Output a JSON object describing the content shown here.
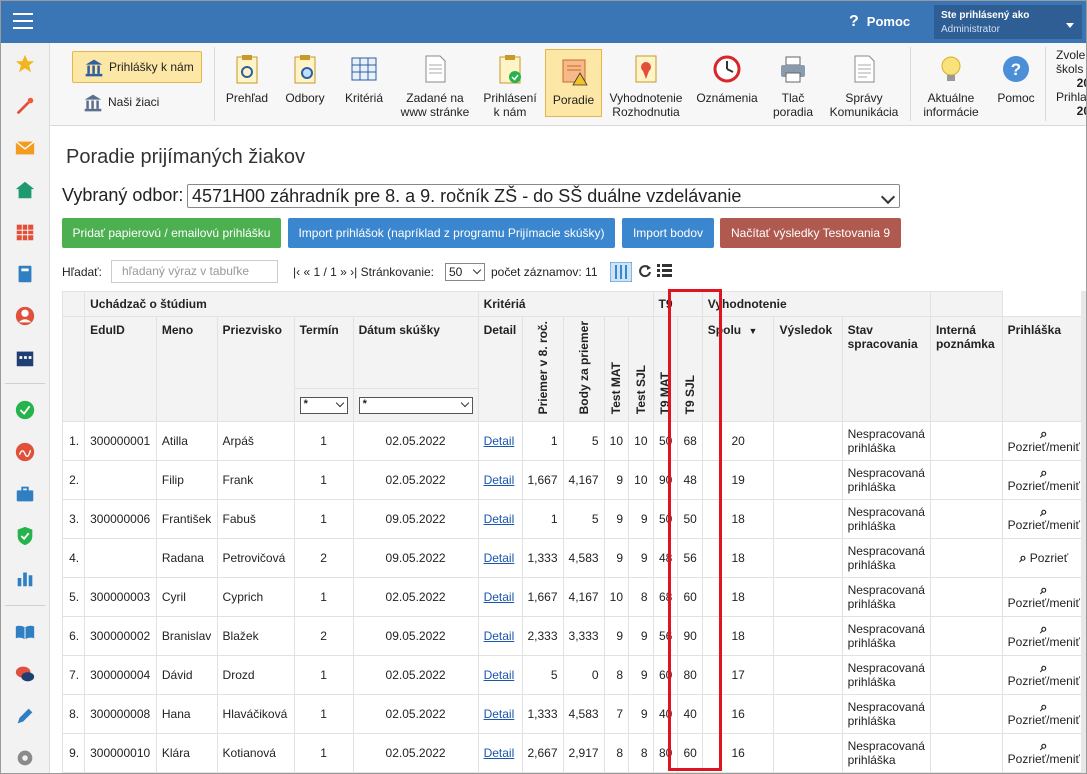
{
  "topbar": {
    "help_label": "Pomoc",
    "user_line1": "Ste prihlásený ako",
    "user_line2": "Administrator"
  },
  "sidebar_icons": [
    "star-icon",
    "magic-wand-icon",
    "mail-icon",
    "home-icon",
    "calendar-grid-icon",
    "book-icon",
    "user-circle-icon",
    "calendar-icon",
    "check-circle-icon",
    "signature-icon",
    "briefcase-icon",
    "shield-check-icon",
    "bar-chart-icon",
    "open-book-icon",
    "chat-icon",
    "pencil-icon",
    "gear-icon"
  ],
  "toolbar": {
    "mini1": "Prihlášky k nám",
    "mini2": "Naši žiaci",
    "items": [
      {
        "label": "Prehľad"
      },
      {
        "label": "Odbory"
      },
      {
        "label": "Kritériá"
      },
      {
        "label": "Zadané na\nwww stránke"
      },
      {
        "label": "Prihlásení\nk nám"
      },
      {
        "label": "Poradie"
      },
      {
        "label": "Vyhodnotenie\nRozhodnutia"
      },
      {
        "label": "Oznámenia"
      },
      {
        "label": "Tlač\nporadia"
      },
      {
        "label": "Správy\nKomunikácia"
      },
      {
        "label": "Aktuálne\ninformácie"
      },
      {
        "label": "Pomoc"
      }
    ],
    "side_lines": [
      "Zvole",
      "škols",
      "20",
      "Prihla",
      "20"
    ]
  },
  "page_title": "Poradie prijímaných žiakov",
  "odbor": {
    "label": "Vybraný odbor:",
    "value": "4571H00 záhradník pre 8. a 9. ročník ZŠ - do SŠ duálne vzdelávanie"
  },
  "buttons": {
    "add_paper": "Pridať papierovú / emailovú prihlášku",
    "import_apps": "Import prihlášok (napríklad z programu Prijímacie skúšky)",
    "import_points": "Import bodov",
    "load_t9": "Načítať výsledky Testovania 9"
  },
  "search": {
    "label": "Hľadať:",
    "placeholder": "hľadaný výraz v tabuľke"
  },
  "pager": {
    "text": "|‹ « 1 / 1 » ›|",
    "paging_label": "Stránkovanie:",
    "page_size": "50",
    "count_label": "počet záznamov: 11"
  },
  "table": {
    "groups": [
      "Uchádzač o štúdium",
      "Kritériá",
      "T9",
      "Vyhodnotenie"
    ],
    "columns": [
      "EduID",
      "Meno",
      "Priezvisko",
      "Termín",
      "Dátum skúšky",
      "Detail",
      "Priemer v 8. roč.",
      "Body za priemer",
      "Test MAT",
      "Test SJL",
      "T9 MAT",
      "T9 SJL",
      "Spolu",
      "Výsledok",
      "Stav spracovania",
      "Interná poznámka",
      "Prihláška"
    ],
    "filter_value": "*",
    "rows": [
      {
        "n": "1.",
        "eduid": "300000001",
        "meno": "Atilla",
        "priezvisko": "Arpáš",
        "termin": "1",
        "datum": "02.05.2022",
        "detail": "Detail",
        "priemer": "1",
        "body": "5",
        "tmat": "10",
        "tsjl": "10",
        "t9mat": "50",
        "t9sjl": "68",
        "spolu": "20",
        "vysledok": "",
        "stav": "Nespracovaná prihláška",
        "poz": "",
        "prihlaska": "Pozrieť/meniť"
      },
      {
        "n": "2.",
        "eduid": "",
        "meno": "Filip",
        "priezvisko": "Frank",
        "termin": "1",
        "datum": "02.05.2022",
        "detail": "Detail",
        "priemer": "1,667",
        "body": "4,167",
        "tmat": "9",
        "tsjl": "10",
        "t9mat": "90",
        "t9sjl": "48",
        "spolu": "19",
        "vysledok": "",
        "stav": "Nespracovaná prihláška",
        "poz": "",
        "prihlaska": "Pozrieť/meniť"
      },
      {
        "n": "3.",
        "eduid": "300000006",
        "meno": "František",
        "priezvisko": "Fabuš",
        "termin": "1",
        "datum": "09.05.2022",
        "detail": "Detail",
        "priemer": "1",
        "body": "5",
        "tmat": "9",
        "tsjl": "9",
        "t9mat": "50",
        "t9sjl": "50",
        "spolu": "18",
        "vysledok": "",
        "stav": "Nespracovaná prihláška",
        "poz": "",
        "prihlaska": "Pozrieť/meniť"
      },
      {
        "n": "4.",
        "eduid": "",
        "meno": "Radana",
        "priezvisko": "Petrovičová",
        "termin": "2",
        "datum": "09.05.2022",
        "detail": "Detail",
        "priemer": "1,333",
        "body": "4,583",
        "tmat": "9",
        "tsjl": "9",
        "t9mat": "48",
        "t9sjl": "56",
        "spolu": "18",
        "vysledok": "",
        "stav": "Nespracovaná prihláška",
        "poz": "",
        "prihlaska": "Pozrieť"
      },
      {
        "n": "5.",
        "eduid": "300000003",
        "meno": "Cyril",
        "priezvisko": "Cyprich",
        "termin": "1",
        "datum": "02.05.2022",
        "detail": "Detail",
        "priemer": "1,667",
        "body": "4,167",
        "tmat": "10",
        "tsjl": "8",
        "t9mat": "68",
        "t9sjl": "60",
        "spolu": "18",
        "vysledok": "",
        "stav": "Nespracovaná prihláška",
        "poz": "",
        "prihlaska": "Pozrieť/meniť"
      },
      {
        "n": "6.",
        "eduid": "300000002",
        "meno": "Branislav",
        "priezvisko": "Blažek",
        "termin": "2",
        "datum": "09.05.2022",
        "detail": "Detail",
        "priemer": "2,333",
        "body": "3,333",
        "tmat": "9",
        "tsjl": "9",
        "t9mat": "56",
        "t9sjl": "90",
        "spolu": "18",
        "vysledok": "",
        "stav": "Nespracovaná prihláška",
        "poz": "",
        "prihlaska": "Pozrieť/meniť"
      },
      {
        "n": "7.",
        "eduid": "300000004",
        "meno": "Dávid",
        "priezvisko": "Drozd",
        "termin": "1",
        "datum": "02.05.2022",
        "detail": "Detail",
        "priemer": "5",
        "body": "0",
        "tmat": "8",
        "tsjl": "9",
        "t9mat": "60",
        "t9sjl": "80",
        "spolu": "17",
        "vysledok": "",
        "stav": "Nespracovaná prihláška",
        "poz": "",
        "prihlaska": "Pozrieť/meniť"
      },
      {
        "n": "8.",
        "eduid": "300000008",
        "meno": "Hana",
        "priezvisko": "Hlaváčiková",
        "termin": "1",
        "datum": "02.05.2022",
        "detail": "Detail",
        "priemer": "1,333",
        "body": "4,583",
        "tmat": "7",
        "tsjl": "9",
        "t9mat": "40",
        "t9sjl": "40",
        "spolu": "16",
        "vysledok": "",
        "stav": "Nespracovaná prihláška",
        "poz": "",
        "prihlaska": "Pozrieť/meniť"
      },
      {
        "n": "9.",
        "eduid": "300000010",
        "meno": "Klára",
        "priezvisko": "Kotianová",
        "termin": "1",
        "datum": "02.05.2022",
        "detail": "Detail",
        "priemer": "2,667",
        "body": "2,917",
        "tmat": "8",
        "tsjl": "8",
        "t9mat": "80",
        "t9sjl": "60",
        "spolu": "16",
        "vysledok": "",
        "stav": "Nespracovaná prihláška",
        "poz": "",
        "prihlaska": "Pozrieť/meniť"
      }
    ]
  },
  "colors": {
    "topbar": "#3a75b5",
    "highlight": "#e0141e",
    "btn_green": "#4caf50",
    "btn_blue": "#3b87cf",
    "btn_brown": "#b05a4f",
    "poradie_active": "#fde7a6"
  }
}
